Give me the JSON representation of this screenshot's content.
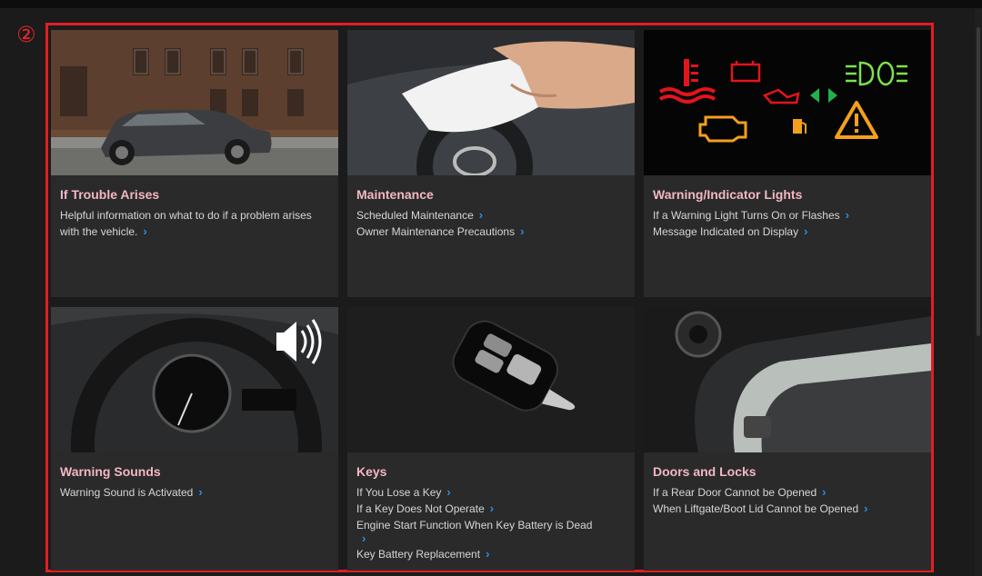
{
  "marker": "②",
  "cards": [
    {
      "title": "If Trouble Arises",
      "description": "Helpful information on what to do if a problem arises with the vehicle.",
      "image_icon": "car-photo"
    },
    {
      "title": "Maintenance",
      "links": [
        "Scheduled Maintenance",
        "Owner Maintenance Precautions"
      ],
      "image_icon": "dashboard-cleaning-photo"
    },
    {
      "title": "Warning/Indicator Lights",
      "links": [
        "If a Warning Light Turns On or Flashes",
        "Message Indicated on Display"
      ],
      "image_icon": "warning-lights-icons"
    },
    {
      "title": "Warning Sounds",
      "links": [
        "Warning Sound is Activated"
      ],
      "image_icon": "instrument-cluster-speaker-photo"
    },
    {
      "title": "Keys",
      "links": [
        "If You Lose a Key",
        "If a Key Does Not Operate",
        "Engine Start Function When Key Battery is Dead",
        "Key Battery Replacement"
      ],
      "image_icon": "smart-key-photo"
    },
    {
      "title": "Doors and Locks",
      "links": [
        "If a Rear Door Cannot be Opened",
        "When Liftgate/Boot Lid Cannot be Opened"
      ],
      "image_icon": "door-interior-photo"
    }
  ],
  "colors": {
    "frame": "#e21d24",
    "title": "#f3b7c4",
    "chevron": "#2a8fe6",
    "card_bg": "#2a2a2a"
  }
}
